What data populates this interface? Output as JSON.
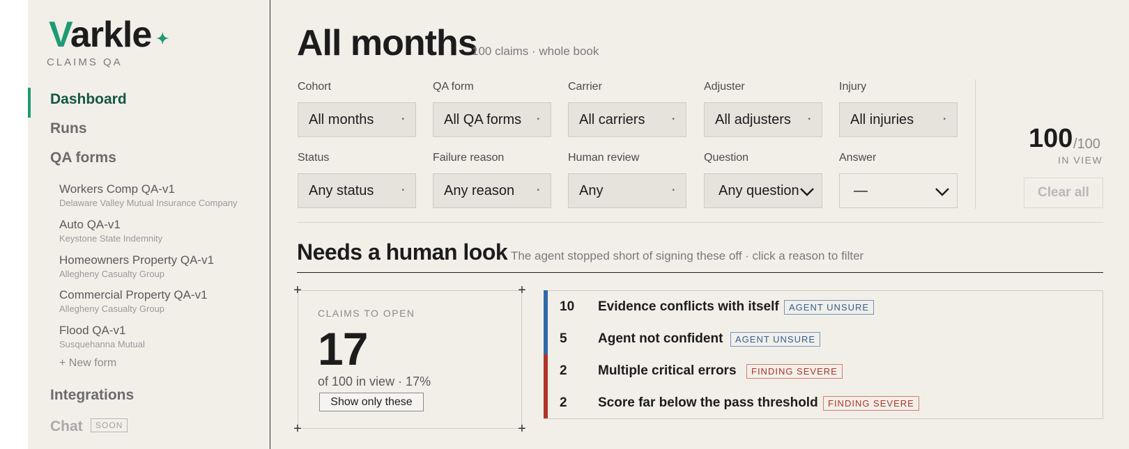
{
  "brand": {
    "initial": "V",
    "rest": "arkle",
    "spark": "✦",
    "subtitle": "CLAIMS QA"
  },
  "nav": {
    "dashboard": "Dashboard",
    "runs": "Runs",
    "qa_forms": "QA forms",
    "integrations": "Integrations",
    "chat": "Chat",
    "chat_badge": "SOON",
    "forms": [
      {
        "title": "Workers Comp QA-v1",
        "carrier": "Delaware Valley Mutual Insurance Company"
      },
      {
        "title": "Auto QA-v1",
        "carrier": "Keystone State Indemnity"
      },
      {
        "title": "Homeowners Property QA-v1",
        "carrier": "Allegheny Casualty Group"
      },
      {
        "title": "Commercial Property QA-v1",
        "carrier": "Allegheny Casualty Group"
      },
      {
        "title": "Flood QA-v1",
        "carrier": "Susquehanna Mutual"
      }
    ],
    "new_form": "+ New form"
  },
  "header": {
    "title": "All months",
    "subtitle": "100 claims · whole book"
  },
  "filters": {
    "cohort": {
      "label": "Cohort",
      "value": "All months"
    },
    "qa_form": {
      "label": "QA form",
      "value": "All QA forms"
    },
    "carrier": {
      "label": "Carrier",
      "value": "All carriers"
    },
    "adjuster": {
      "label": "Adjuster",
      "value": "All adjusters"
    },
    "injury": {
      "label": "Injury",
      "value": "All injuries"
    },
    "status": {
      "label": "Status",
      "value": "Any status"
    },
    "failure_reason": {
      "label": "Failure reason",
      "value": "Any reason"
    },
    "human_review": {
      "label": "Human review",
      "value": "Any"
    },
    "question": {
      "label": "Question",
      "value": "Any question"
    },
    "answer": {
      "label": "Answer",
      "value": "—"
    }
  },
  "summary": {
    "in_view": "100",
    "total": "/100",
    "in_view_label": "IN VIEW",
    "clear_all": "Clear all"
  },
  "needs_look": {
    "title": "Needs a human look",
    "subtitle": "The agent stopped short of signing these off · click a reason to filter",
    "claims_label": "CLAIMS TO OPEN",
    "claims_count": "17",
    "claims_of": "of 100 in view · 17%",
    "show_only": "Show only these",
    "reasons": [
      {
        "count": "10",
        "text": "Evidence conflicts with itself",
        "tag": "AGENT UNSURE",
        "color": "#2f6aa8"
      },
      {
        "count": "5",
        "text": "Agent not confident",
        "tag": "AGENT UNSURE",
        "color": "#2f6aa8"
      },
      {
        "count": "2",
        "text": "Multiple critical errors",
        "tag": "FINDING SEVERE",
        "color": "#b3322a"
      },
      {
        "count": "2",
        "text": "Score far below the pass threshold",
        "tag": "FINDING SEVERE",
        "color": "#b3322a"
      }
    ]
  }
}
